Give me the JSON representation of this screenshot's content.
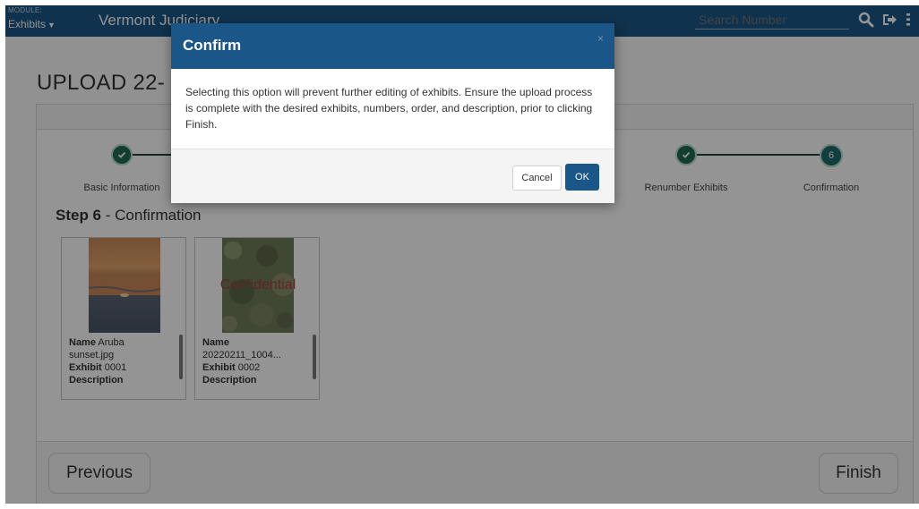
{
  "topnav": {
    "module_label": "MODULE:",
    "module_value": "Exhibits",
    "brand": "Vermont Judiciary",
    "search_placeholder": "Search Number"
  },
  "page": {
    "title": "UPLOAD 22-"
  },
  "steps": {
    "items": [
      {
        "label": "Basic Information",
        "status": "complete"
      },
      {
        "label": "Renumber Exhibits",
        "status": "complete"
      },
      {
        "label": "Confirmation",
        "status": "current",
        "number": "6"
      }
    ],
    "current_title_bold": "Step 6",
    "current_title_rest": " - Confirmation"
  },
  "exhibits": [
    {
      "name_label": "Name",
      "name_value": " Aruba",
      "name_cont": "sunset.jpg",
      "exhibit_label": "Exhibit",
      "exhibit_value": " 0001",
      "description_label": "Description"
    },
    {
      "name_label": "Name",
      "name_value": "",
      "name_cont": "20220211_1004...",
      "exhibit_label": "Exhibit",
      "exhibit_value": " 0002",
      "description_label": "Description",
      "watermark": "Confidential"
    }
  ],
  "footer": {
    "previous": "Previous",
    "finish": "Finish"
  },
  "modal": {
    "title": "Confirm",
    "close": "×",
    "body": "Selecting this option will prevent further editing of exhibits. Ensure the upload process is complete with the desired exhibits, numbers, order, and description, prior to clicking Finish.",
    "cancel": "Cancel",
    "ok": "OK"
  },
  "colors": {
    "nav": "#1a5687",
    "step_complete": "#1e6b52",
    "ok_button": "#1a5687"
  }
}
